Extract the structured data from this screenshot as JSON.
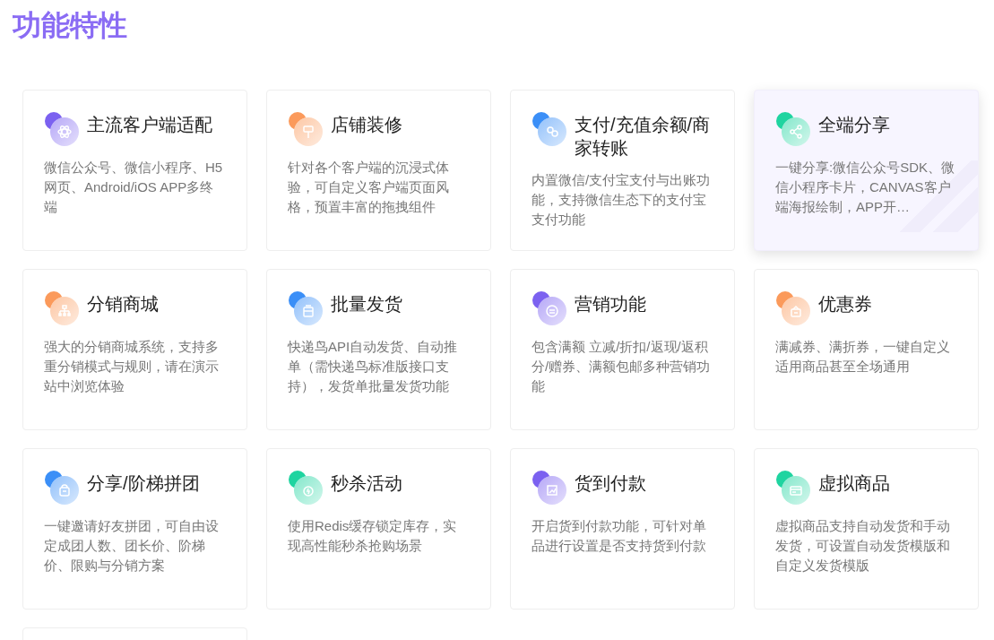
{
  "heading": "功能特性",
  "cards": [
    {
      "kind": "atom",
      "color": "#7b61f0",
      "title": "主流客户端适配",
      "description": "微信公众号、微信小程序、H5网页、Android/iOS APP多终端",
      "highlighted": false
    },
    {
      "kind": "brush",
      "color": "#fb9a5b",
      "title": "店铺装修",
      "description": "针对各个客户端的沉浸式体验，可自定义客户端页面风格，预置丰富的拖拽组件",
      "highlighted": false
    },
    {
      "kind": "pay",
      "color": "#3b8ff7",
      "title": "支付/充值余额/商家转账",
      "description": "内置微信/支付宝支付与出账功能，支持微信生态下的支付宝支付功能",
      "highlighted": false
    },
    {
      "kind": "share",
      "color": "#1fd4a0",
      "title": "全端分享",
      "description": "一键分享:微信公众号SDK、微信小程序卡片，CANVAS客户端海报绘制，APP开…",
      "highlighted": true
    },
    {
      "kind": "tree",
      "color": "#fb9a5b",
      "title": "分销商城",
      "description": "强大的分销商城系统，支持多重分销模式与规则，请在演示站中浏览体验",
      "highlighted": false
    },
    {
      "kind": "box",
      "color": "#3b8ff7",
      "title": "批量发货",
      "description": "快递鸟API自动发货、自动推单（需快递鸟标准版接口支持），发货单批量发货功能",
      "highlighted": false
    },
    {
      "kind": "badge",
      "color": "#7b61f0",
      "title": "营销功能",
      "description": "包含满额 立减/折扣/返现/返积分/赠券、满额包邮多种营销功能",
      "highlighted": false
    },
    {
      "kind": "gift",
      "color": "#fb9a5b",
      "title": "优惠券",
      "description": "满减券、满折券，一键自定义适用商品甚至全场通用",
      "highlighted": false
    },
    {
      "kind": "bag",
      "color": "#3b8ff7",
      "title": "分享/阶梯拼团",
      "description": "一键邀请好友拼团，可自由设定成团人数、团长价、阶梯价、限购与分销方案",
      "highlighted": false
    },
    {
      "kind": "clock",
      "color": "#1fd4a0",
      "title": "秒杀活动",
      "description": "使用Redis缓存锁定库存，实现高性能秒杀抢购场景",
      "highlighted": false
    },
    {
      "kind": "chart",
      "color": "#7b61f0",
      "title": "货到付款",
      "description": "开启货到付款功能，可针对单品进行设置是否支持货到付款",
      "highlighted": false
    },
    {
      "kind": "card",
      "color": "#1fd4a0",
      "title": "虚拟商品",
      "description": "虚拟商品支持自动发货和手动发货，可设置自动发货模版和自定义发货模版",
      "highlighted": false
    }
  ],
  "more_cards_below": true
}
